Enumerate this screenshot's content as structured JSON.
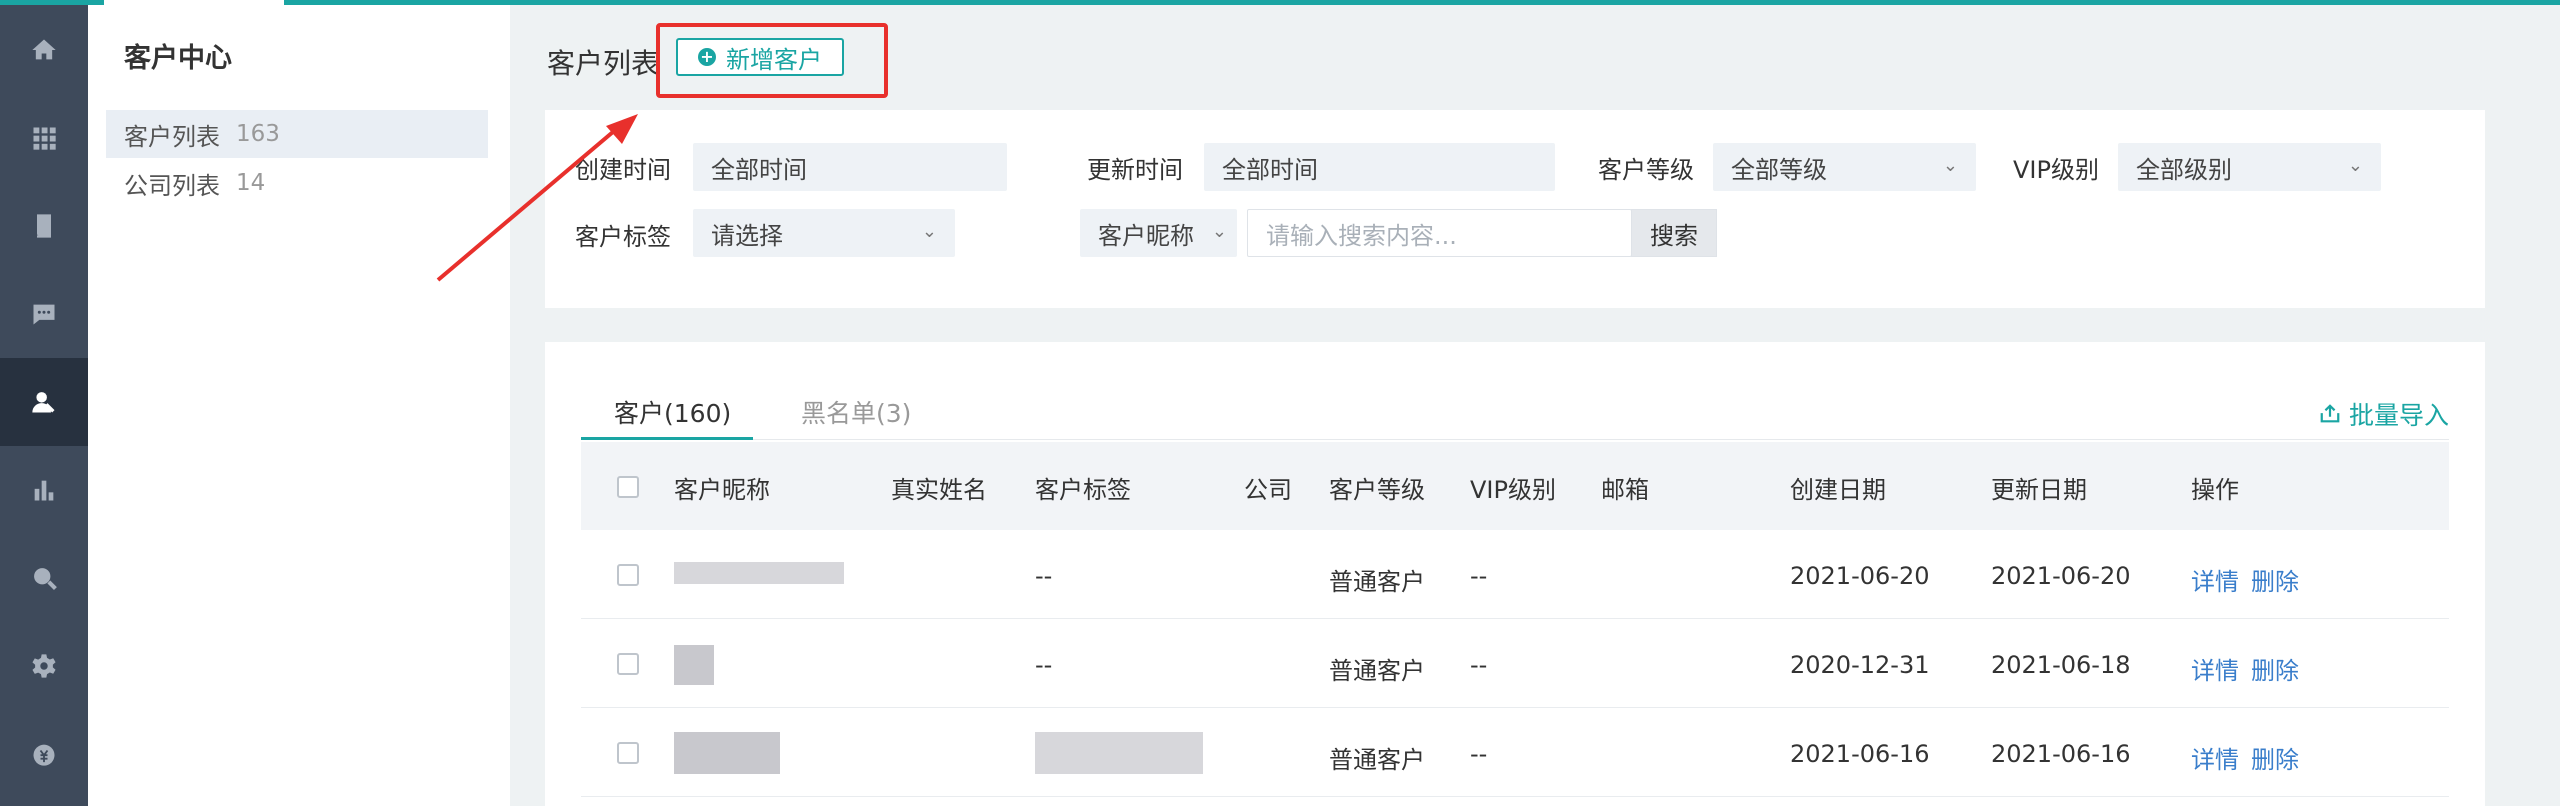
{
  "nav_rail": {
    "items": [
      {
        "icon": "home-icon"
      },
      {
        "icon": "apps-grid-icon"
      },
      {
        "icon": "book-icon"
      },
      {
        "icon": "chat-icon"
      },
      {
        "icon": "customer-icon",
        "active": true
      },
      {
        "icon": "bar-chart-icon"
      },
      {
        "icon": "search-icon"
      },
      {
        "icon": "gear-icon"
      },
      {
        "icon": "money-bag-icon"
      }
    ]
  },
  "sidebar": {
    "title": "客户中心",
    "items": [
      {
        "label": "客户列表",
        "count": "163",
        "active": true
      },
      {
        "label": "公司列表",
        "count": "14"
      }
    ]
  },
  "main": {
    "title": "客户列表",
    "add_button": "新增客户"
  },
  "filters": {
    "created_label": "创建时间",
    "created_value": "全部时间",
    "updated_label": "更新时间",
    "updated_value": "全部时间",
    "level_label": "客户等级",
    "level_value": "全部等级",
    "vip_label": "VIP级别",
    "vip_value": "全部级别",
    "tag_label": "客户标签",
    "tag_value": "请选择",
    "field_select": "客户昵称",
    "search_placeholder": "请输入搜索内容...",
    "search_button": "搜索"
  },
  "tabs": [
    {
      "label": "客户(160)",
      "active": true
    },
    {
      "label": "黑名单(3)"
    }
  ],
  "import_label": "批量导入",
  "table": {
    "columns": [
      "客户昵称",
      "真实姓名",
      "客户标签",
      "公司",
      "客户等级",
      "VIP级别",
      "邮箱",
      "创建日期",
      "更新日期",
      "操作"
    ],
    "rows": [
      {
        "tag": "--",
        "level": "普通客户",
        "vip": "--",
        "created": "2021-06-20",
        "updated": "2021-06-20",
        "detail": "详情",
        "delete": "删除"
      },
      {
        "tag": "--",
        "level": "普通客户",
        "vip": "--",
        "created": "2020-12-31",
        "updated": "2021-06-18",
        "detail": "详情",
        "delete": "删除"
      },
      {
        "tag": "",
        "level": "普通客户",
        "vip": "--",
        "created": "2021-06-16",
        "updated": "2021-06-16",
        "detail": "详情",
        "delete": "删除"
      }
    ]
  },
  "colors": {
    "accent": "#1aa5a3",
    "link": "#3a7ecb",
    "highlight": "#e8302c",
    "rail": "#3e4a5b"
  }
}
